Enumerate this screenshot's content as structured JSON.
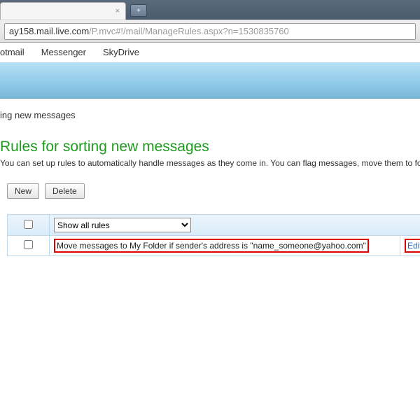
{
  "browser": {
    "url_host": "ay158.mail.live.com",
    "url_path": "/P.mvc#!/mail/ManageRules.aspx?n=1530835760",
    "tab_close": "×",
    "new_tab": "+"
  },
  "nav": {
    "items": [
      "otmail",
      "Messenger",
      "SkyDrive"
    ]
  },
  "crumb": {
    "text": "ing new messages"
  },
  "page": {
    "title": "Rules for sorting new messages",
    "desc": "You can set up rules to automatically handle messages as they come in. You can flag messages, move them to fo"
  },
  "buttons": {
    "new_label": "New",
    "delete_label": "Delete"
  },
  "filter": {
    "selected": "Show all rules"
  },
  "rule_row": {
    "description": "Move messages to My Folder if sender's address is \"name_someone@yahoo.com\"",
    "edit_label": "Edit"
  }
}
